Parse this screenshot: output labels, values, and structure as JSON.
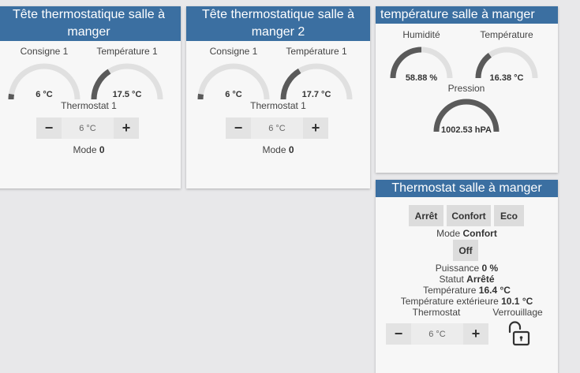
{
  "cards": [
    {
      "title": "Tête thermostatique salle à manger",
      "consigne_label": "Consigne 1",
      "consigne_value": "6 °C",
      "consigne_fraction": 0.05,
      "temp_label": "Température 1",
      "temp_value": "17.5 °C",
      "temp_fraction": 0.32,
      "thermostat_label": "Thermostat 1",
      "setpoint": "6 °C",
      "mode_label": "Mode",
      "mode_value": "0"
    },
    {
      "title": "Tête thermostatique salle à manger 2",
      "consigne_label": "Consigne 1",
      "consigne_value": "6 °C",
      "consigne_fraction": 0.05,
      "temp_label": "Température 1",
      "temp_value": "17.7 °C",
      "temp_fraction": 0.33,
      "thermostat_label": "Thermostat 1",
      "setpoint": "6 °C",
      "mode_label": "Mode",
      "mode_value": "0"
    }
  ],
  "sensor": {
    "title": "température salle à manger",
    "humidity_label": "Humidité",
    "humidity_value": "58.88 %",
    "humidity_fraction": 0.5,
    "temp_label": "Température",
    "temp_value": "16.38 °C",
    "temp_fraction": 0.3,
    "pressure_label": "Pression",
    "pressure_value": "1002.53 hPA",
    "pressure_fraction": 1.0
  },
  "thermostat": {
    "title": "Thermostat salle à manger",
    "modes": [
      "Arrêt",
      "Confort",
      "Eco"
    ],
    "mode_label": "Mode",
    "mode_value": "Confort",
    "off_label": "Off",
    "power_label": "Puissance",
    "power_value": "0 %",
    "status_label": "Statut",
    "status_value": "Arrêté",
    "temp_label": "Température",
    "temp_value": "16.4 °C",
    "ext_label": "Température extérieure",
    "ext_value": "10.1 °C",
    "thermostat_label": "Thermostat",
    "lock_label": "Verrouillage",
    "setpoint": "6 °C"
  },
  "colors": {
    "header": "#3b6fa1",
    "gauge_track": "#e0e0e0",
    "gauge_fill": "#5a5a5a"
  }
}
